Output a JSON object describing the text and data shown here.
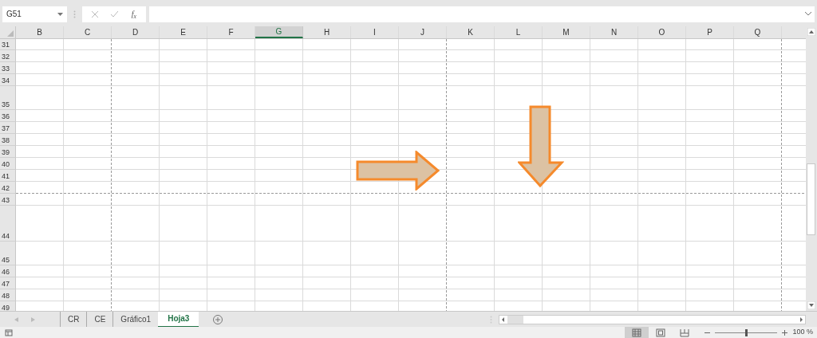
{
  "formula_bar": {
    "name_box": "G51",
    "function_label": "f$_{x}$"
  },
  "columns": [
    {
      "label": "B",
      "selected": false
    },
    {
      "label": "C",
      "selected": false
    },
    {
      "label": "D",
      "selected": false
    },
    {
      "label": "E",
      "selected": false
    },
    {
      "label": "F",
      "selected": false
    },
    {
      "label": "G",
      "selected": true
    },
    {
      "label": "H",
      "selected": false
    },
    {
      "label": "I",
      "selected": false
    },
    {
      "label": "J",
      "selected": false
    },
    {
      "label": "K",
      "selected": false
    },
    {
      "label": "L",
      "selected": false
    },
    {
      "label": "M",
      "selected": false
    },
    {
      "label": "N",
      "selected": false
    },
    {
      "label": "O",
      "selected": false
    },
    {
      "label": "P",
      "selected": false
    },
    {
      "label": "Q",
      "selected": false
    }
  ],
  "rows": [
    "31",
    "32",
    "33",
    "34",
    "35",
    "36",
    "37",
    "38",
    "39",
    "40",
    "41",
    "42",
    "43",
    "44",
    "45",
    "46",
    "47",
    "48",
    "49"
  ],
  "shapes": [
    {
      "kind": "right-arrow"
    },
    {
      "kind": "down-arrow"
    }
  ],
  "sheet_tabs": [
    {
      "label": "CR",
      "selected": false
    },
    {
      "label": "CE",
      "selected": false
    },
    {
      "label": "Gráfico1",
      "selected": false
    },
    {
      "label": "Hoja3",
      "selected": true
    }
  ],
  "status_bar": {
    "views": [
      {
        "kind": "normal",
        "selected": true
      },
      {
        "kind": "page-layout",
        "selected": false
      },
      {
        "kind": "page-break",
        "selected": false
      }
    ],
    "zoom": {
      "level": 0.5,
      "reading": "100 %"
    }
  }
}
